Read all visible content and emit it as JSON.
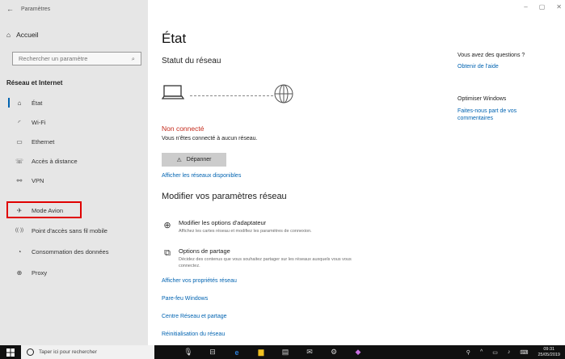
{
  "window": {
    "title": "Paramètres",
    "controls": [
      "–",
      "▢",
      "✕"
    ]
  },
  "sidebar": {
    "home": "Accueil",
    "search_placeholder": "Rechercher un paramètre",
    "section_title": "Réseau et Internet",
    "items": [
      {
        "label": "État",
        "icon": "home-network-icon",
        "glyph": "⌂"
      },
      {
        "label": "Wi-Fi",
        "icon": "wifi-icon",
        "glyph": "◜"
      },
      {
        "label": "Ethernet",
        "icon": "ethernet-icon",
        "glyph": "▭"
      },
      {
        "label": "Accès à distance",
        "icon": "dialup-icon",
        "glyph": "☏"
      },
      {
        "label": "VPN",
        "icon": "vpn-icon",
        "glyph": "⚯"
      },
      {
        "label": "Mode Avion",
        "icon": "airplane-icon",
        "glyph": "✈"
      },
      {
        "label": "Point d'accès sans fil mobile",
        "icon": "hotspot-icon",
        "glyph": "((·))"
      },
      {
        "label": "Consommation des données",
        "icon": "data-usage-icon",
        "glyph": "◔"
      },
      {
        "label": "Proxy",
        "icon": "proxy-icon",
        "glyph": "⊕"
      }
    ]
  },
  "main": {
    "title": "État",
    "network_status": "Statut du réseau",
    "status_label": "Non connecté",
    "status_sub": "Vous n'êtes connecté à aucun réseau.",
    "repair_button": "Dépanner",
    "show_networks_link": "Afficher les réseaux disponibles",
    "section2_title": "Modifier vos paramètres réseau",
    "options": [
      {
        "title": "Modifier les options d'adaptateur",
        "desc": "Affichez les cartes réseau et modifiez les paramètres de connexion."
      },
      {
        "title": "Options de partage",
        "desc": "Décidez des contenus que vous souhaitez partager sur les réseaux auxquels vous vous connectez."
      }
    ],
    "links": [
      "Afficher vos propriétés réseau",
      "Pare-feu Windows",
      "Centre Réseau et partage",
      "Réinitialisation du réseau"
    ]
  },
  "right": {
    "question": "Vous avez des questions ?",
    "help_link": "Obtenir de l'aide",
    "optimize": "Optimiser Windows",
    "feedback_link": "Faites-nous part de vos commentaires"
  },
  "taskbar": {
    "search_placeholder": "Taper ici pour rechercher",
    "time": "09:31",
    "date": "25/05/2019"
  },
  "colors": {
    "accent": "#0063b1",
    "error": "#c42b1c",
    "sidebar_bg": "#e6e6e6",
    "highlight": "#e00000"
  }
}
